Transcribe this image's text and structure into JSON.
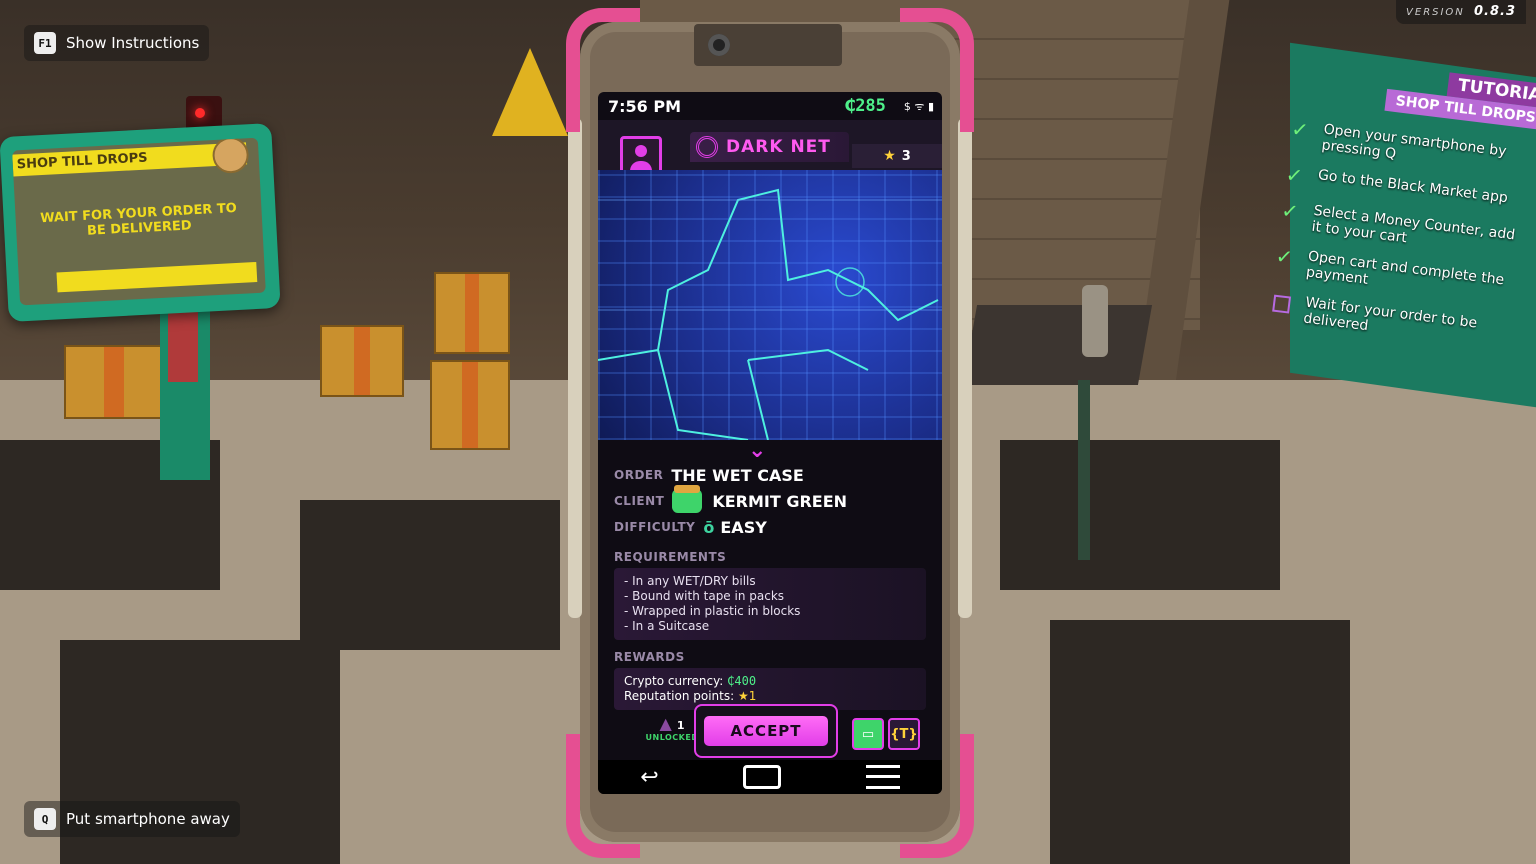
{
  "hud": {
    "instructions_key": "F1",
    "instructions_label": "Show Instructions",
    "put_away_key": "Q",
    "put_away_label": "Put smartphone away",
    "version_label": "VERSION",
    "version_value": "0.8.3"
  },
  "left_sign": {
    "header": "SHOP TILL DROPS",
    "message": "WAIT FOR YOUR ORDER TO BE DELIVERED"
  },
  "tutorial": {
    "title": "TUTORIAL",
    "subtitle": "SHOP TILL DROPS",
    "steps": [
      {
        "text": "Open your smartphone by pressing Q",
        "done": true
      },
      {
        "text": "Go to the Black Market app",
        "done": true
      },
      {
        "text": "Select a Money Counter, add it to your cart",
        "done": true
      },
      {
        "text": "Open cart and complete the payment",
        "done": true
      },
      {
        "text": "Wait for your order to be delivered",
        "done": false
      }
    ]
  },
  "phone": {
    "time": "7:56 PM",
    "balance": "₵285",
    "status_icons": "$ ᯤ ▮",
    "app_name": "DARK NET",
    "reputation": "3",
    "order_label": "ORDER",
    "order_value": "THE WET CASE",
    "client_label": "CLIENT",
    "client_value": "KERMIT GREEN",
    "difficulty_label": "DIFFICULTY",
    "difficulty_value": "EASY",
    "requirements_title": "REQUIREMENTS",
    "requirements": [
      "- In any WET/DRY bills",
      "- Bound with tape in packs",
      "- Wrapped in plastic in blocks",
      "- In a Suitcase"
    ],
    "rewards_title": "REWARDS",
    "reward_crypto_label": "Crypto currency:",
    "reward_crypto_value": "₵400",
    "reward_rep_label": "Reputation points:",
    "reward_rep_value": "★1",
    "unlocked_count": "1",
    "unlocked_label": "UNLOCKED",
    "accept_label": "ACCEPT"
  },
  "colors": {
    "accent": "#e23ee8",
    "money_green": "#4ef08a",
    "bumper_pink": "#e54f92",
    "check_green": "#6ef07a"
  }
}
